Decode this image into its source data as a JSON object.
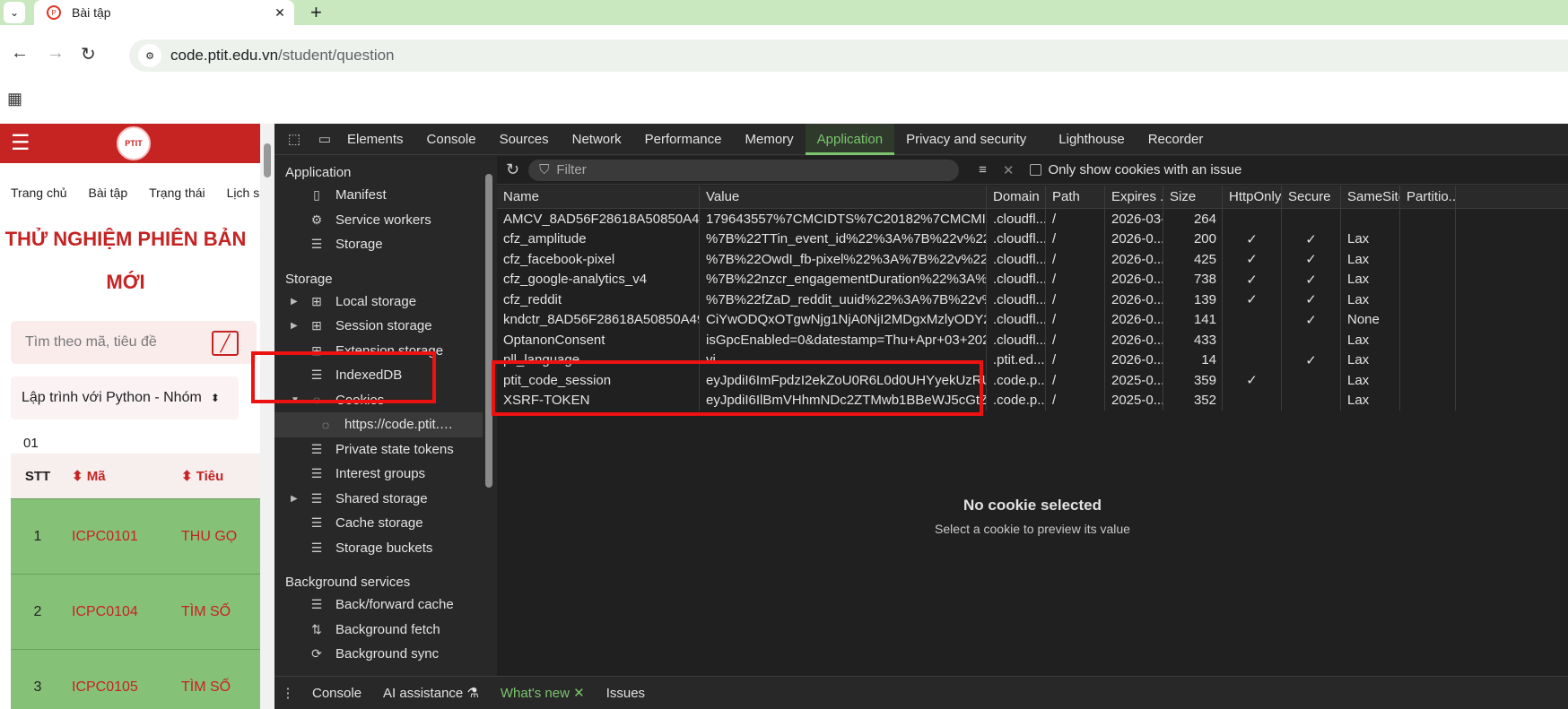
{
  "browser": {
    "tab_title": "Bài tập",
    "url_host": "code.ptit.edu.vn",
    "url_path": "/student/question"
  },
  "page": {
    "nav": [
      "Trang chủ",
      "Bài tập",
      "Trạng thái",
      "Lịch sử"
    ],
    "heading": "THỬ NGHIỆM PHIÊN BẢN MỚI",
    "search_placeholder": "Tìm theo mã, tiêu đề",
    "select_value": "Lập trình với Python - Nhóm",
    "table_caption": "01",
    "table_headers": [
      "STT",
      "Mã",
      "Tiêu"
    ],
    "rows": [
      {
        "stt": "1",
        "code": "ICPC0101",
        "title": "THU GỌ"
      },
      {
        "stt": "2",
        "code": "ICPC0104",
        "title": "TÌM SỐ"
      },
      {
        "stt": "3",
        "code": "ICPC0105",
        "title": "TÌM SỐ"
      }
    ]
  },
  "devtools": {
    "tabs": [
      "Elements",
      "Console",
      "Sources",
      "Network",
      "Performance",
      "Memory",
      "Application",
      "Privacy and security",
      "Lighthouse",
      "Recorder"
    ],
    "active_tab": "Application",
    "sidebar": {
      "application_header": "Application",
      "application_items": [
        "Manifest",
        "Service workers",
        "Storage"
      ],
      "storage_header": "Storage",
      "storage_items": [
        "Local storage",
        "Session storage",
        "Extension storage",
        "IndexedDB",
        "Cookies"
      ],
      "cookie_child": "https://code.ptit.edu.vn",
      "storage_items2": [
        "Private state tokens",
        "Interest groups",
        "Shared storage",
        "Cache storage",
        "Storage buckets"
      ],
      "background_header": "Background services",
      "background_items": [
        "Back/forward cache",
        "Background fetch",
        "Background sync"
      ]
    },
    "filter_placeholder": "Filter",
    "only_issue_label": "Only show cookies with an issue",
    "columns": [
      "Name",
      "Value",
      "Domain",
      "Path",
      "Expires ...",
      "Size",
      "HttpOnly",
      "Secure",
      "SameSite",
      "Partitio..."
    ],
    "cookies": [
      {
        "name": "AMCV_8AD56F28618A50850A495...",
        "value": "179643557%7CMCIDTS%7C20182%7CMCMID%7...",
        "domain": ".cloudfl...",
        "path": "/",
        "expires": "2026-03-...",
        "size": "264",
        "httponly": "",
        "secure": "",
        "samesite": ""
      },
      {
        "name": "cfz_amplitude",
        "value": "%7B%22TTin_event_id%22%3A%7B%22v%22%3A...",
        "domain": ".cloudfl...",
        "path": "/",
        "expires": "2026-0...",
        "size": "200",
        "httponly": "✓",
        "secure": "✓",
        "samesite": "Lax"
      },
      {
        "name": "cfz_facebook-pixel",
        "value": "%7B%22OwdI_fb-pixel%22%3A%7B%22v%22%3A...",
        "domain": ".cloudfl...",
        "path": "/",
        "expires": "2026-0...",
        "size": "425",
        "httponly": "✓",
        "secure": "✓",
        "samesite": "Lax"
      },
      {
        "name": "cfz_google-analytics_v4",
        "value": "%7B%22nzcr_engagementDuration%22%3A%7B%...",
        "domain": ".cloudfl...",
        "path": "/",
        "expires": "2026-0...",
        "size": "738",
        "httponly": "✓",
        "secure": "✓",
        "samesite": "Lax"
      },
      {
        "name": "cfz_reddit",
        "value": "%7B%22fZaD_reddit_uuid%22%3A%7B%22v%22...",
        "domain": ".cloudfl...",
        "path": "/",
        "expires": "2026-0...",
        "size": "139",
        "httponly": "✓",
        "secure": "✓",
        "samesite": "Lax"
      },
      {
        "name": "kndctr_8AD56F28618A50850A495...",
        "value": "CiYwODQxOTgwNjg1NjA0NjI2MDgxMzlyODY2ND...",
        "domain": ".cloudfl...",
        "path": "/",
        "expires": "2026-0...",
        "size": "141",
        "httponly": "",
        "secure": "✓",
        "samesite": "None"
      },
      {
        "name": "OptanonConsent",
        "value": "isGpcEnabled=0&datestamp=Thu+Apr+03+2025...",
        "domain": ".cloudfl...",
        "path": "/",
        "expires": "2026-0...",
        "size": "433",
        "httponly": "",
        "secure": "",
        "samesite": "Lax"
      },
      {
        "name": "pll_language",
        "value": "vi",
        "domain": ".ptit.ed...",
        "path": "/",
        "expires": "2026-0...",
        "size": "14",
        "httponly": "",
        "secure": "✓",
        "samesite": "Lax"
      },
      {
        "name": "ptit_code_session",
        "value": "eyJpdiI6ImFpdzI2ekZoU0R6L0d0UHYyekUzRUE9P...",
        "domain": ".code.p...",
        "path": "/",
        "expires": "2025-0...",
        "size": "359",
        "httponly": "✓",
        "secure": "",
        "samesite": "Lax"
      },
      {
        "name": "XSRF-TOKEN",
        "value": "eyJpdiI6IlBmVHhmNDc2ZTMwb1BBeWJ5cGtZU2c...",
        "domain": ".code.p...",
        "path": "/",
        "expires": "2025-0...",
        "size": "352",
        "httponly": "",
        "secure": "",
        "samesite": "Lax"
      }
    ],
    "empty_title": "No cookie selected",
    "empty_subtitle": "Select a cookie to preview its value",
    "drawer_tabs": [
      "Console",
      "AI assistance",
      "What's new",
      "Issues"
    ]
  },
  "colors": {
    "accent": "#7cc46e",
    "brand_red": "#c62323",
    "highlight": "#e11111",
    "row_green": "#86c178"
  }
}
